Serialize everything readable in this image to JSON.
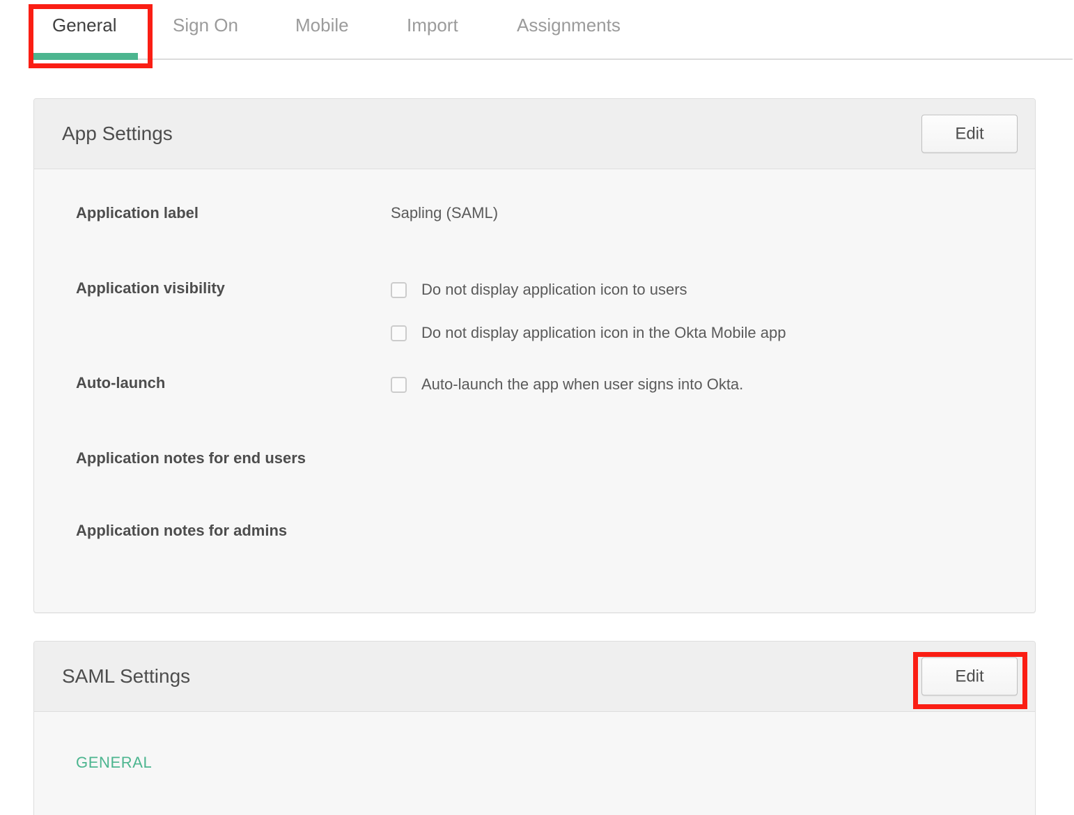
{
  "tabs": [
    {
      "id": "general",
      "label": "General",
      "active": true
    },
    {
      "id": "signon",
      "label": "Sign On",
      "active": false
    },
    {
      "id": "mobile",
      "label": "Mobile",
      "active": false
    },
    {
      "id": "import",
      "label": "Import",
      "active": false
    },
    {
      "id": "assignments",
      "label": "Assignments",
      "active": false
    }
  ],
  "colors": {
    "accent_green": "#4cb58f",
    "highlight_red": "#fa1e14",
    "panel_header_bg": "#efefef",
    "panel_body_bg": "#f7f7f7",
    "label_text": "#4d4d4d",
    "value_text": "#5a5a5a",
    "inactive_tab_text": "#9b9b9b"
  },
  "app_settings": {
    "title": "App Settings",
    "edit_label": "Edit",
    "fields": {
      "application_label": {
        "label": "Application label",
        "value": "Sapling (SAML)"
      },
      "application_visibility": {
        "label": "Application visibility",
        "options": [
          {
            "text": "Do not display application icon to users",
            "checked": false
          },
          {
            "text": "Do not display application icon in the Okta Mobile app",
            "checked": false
          }
        ]
      },
      "auto_launch": {
        "label": "Auto-launch",
        "options": [
          {
            "text": "Auto-launch the app when user signs into Okta.",
            "checked": false
          }
        ]
      },
      "notes_end_users": {
        "label": "Application notes for end users",
        "value": ""
      },
      "notes_admins": {
        "label": "Application notes for admins",
        "value": ""
      }
    }
  },
  "saml_settings": {
    "title": "SAML Settings",
    "edit_label": "Edit",
    "section_general": "GENERAL"
  }
}
